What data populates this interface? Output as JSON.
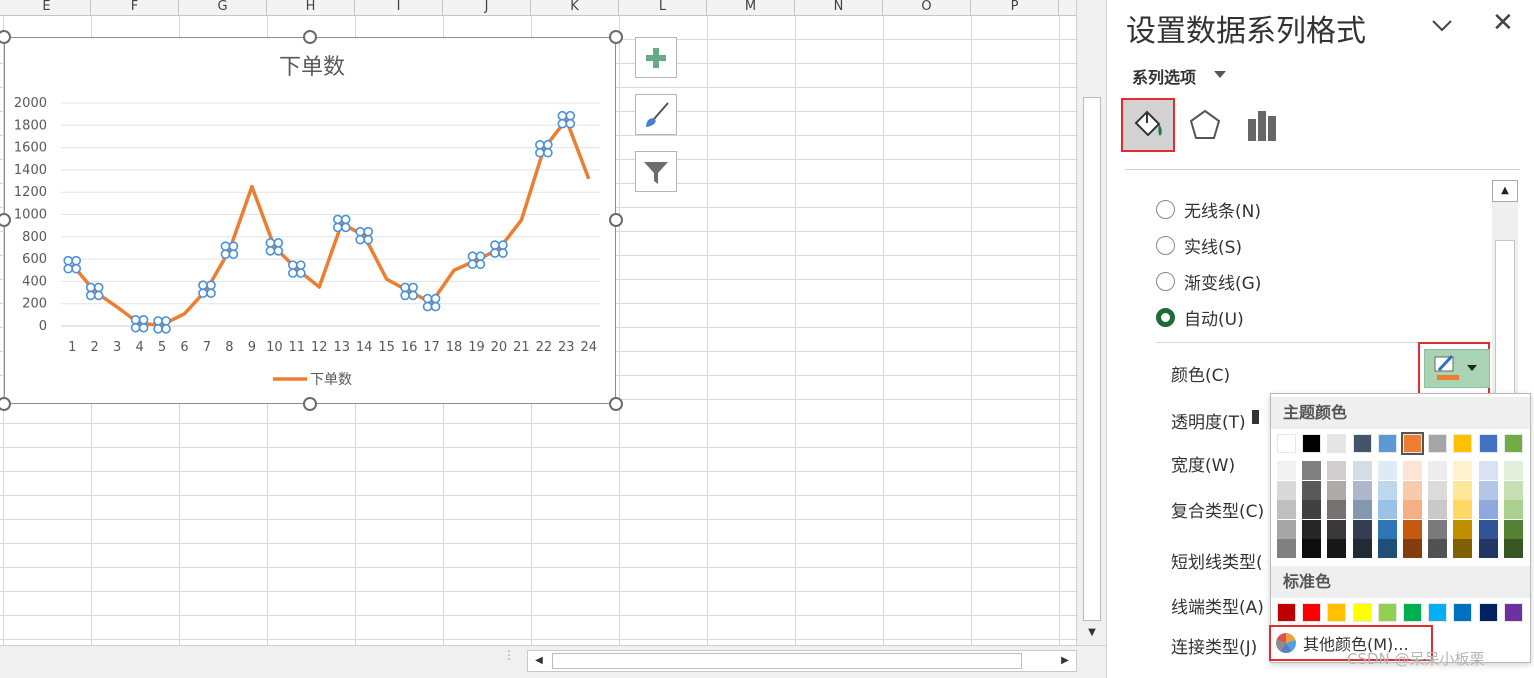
{
  "sheet": {
    "columns": [
      "E",
      "F",
      "G",
      "H",
      "I",
      "J",
      "K",
      "L",
      "M",
      "N",
      "O",
      "P"
    ]
  },
  "chart_data": {
    "type": "line",
    "title": "下单数",
    "categories": [
      "1",
      "2",
      "3",
      "4",
      "5",
      "6",
      "7",
      "8",
      "9",
      "10",
      "11",
      "12",
      "13",
      "14",
      "15",
      "16",
      "17",
      "18",
      "19",
      "20",
      "21",
      "22",
      "23",
      "24"
    ],
    "series": [
      {
        "name": "下单数",
        "color": "#ED7D31",
        "values": [
          550,
          310,
          170,
          20,
          10,
          110,
          330,
          680,
          1250,
          710,
          510,
          350,
          920,
          810,
          420,
          310,
          210,
          500,
          590,
          690,
          950,
          1590,
          1850,
          1320
        ],
        "selected_points": [
          1,
          2,
          4,
          5,
          7,
          8,
          10,
          11,
          13,
          14,
          16,
          17,
          19,
          20,
          22,
          23
        ]
      }
    ],
    "y_ticks": [
      "0",
      "200",
      "400",
      "600",
      "800",
      "1000",
      "1200",
      "1400",
      "1600",
      "1800",
      "2000"
    ],
    "ylim": [
      0,
      2000
    ],
    "grid": true,
    "legend": "bottom"
  },
  "chart_buttons": [
    {
      "name": "chart-elements-button",
      "icon": "plus-icon"
    },
    {
      "name": "chart-styles-button",
      "icon": "brush-icon"
    },
    {
      "name": "chart-filters-button",
      "icon": "filter-icon"
    }
  ],
  "pane": {
    "title": "设置数据系列格式",
    "series_options_label": "系列选项",
    "tabs": [
      {
        "name": "fill-line",
        "icon": "paint-bucket-icon",
        "active": true
      },
      {
        "name": "effects",
        "icon": "pentagon-icon",
        "active": false
      },
      {
        "name": "series-options",
        "icon": "bar-chart-icon",
        "active": false
      }
    ],
    "line_options": [
      {
        "label": "无线条(N)",
        "checked": false
      },
      {
        "label": "实线(S)",
        "checked": false
      },
      {
        "label": "渐变线(G)",
        "checked": false
      },
      {
        "label": "自动(U)",
        "checked": true
      }
    ],
    "props": {
      "color": "颜色(C)",
      "transparency": "透明度(T)",
      "width": "宽度(W)",
      "compound": "复合类型(C)",
      "dash": "短划线类型(",
      "cap": "线端类型(A)",
      "join": "连接类型(J)"
    }
  },
  "color_dropdown": {
    "theme_label": "主题颜色",
    "standard_label": "标准色",
    "more_label": "其他颜色(M)...",
    "theme_colors": [
      "#FFFFFF",
      "#000000",
      "#E7E6E6",
      "#44546A",
      "#5B9BD5",
      "#ED7D31",
      "#A5A5A5",
      "#FFC000",
      "#4472C4",
      "#70AD47"
    ],
    "theme_shades": [
      [
        "#F2F2F2",
        "#D9D9D9",
        "#BFBFBF",
        "#A6A6A6",
        "#808080"
      ],
      [
        "#808080",
        "#595959",
        "#404040",
        "#262626",
        "#0D0D0D"
      ],
      [
        "#D0CECE",
        "#AEAAAA",
        "#757171",
        "#3A3838",
        "#171717"
      ],
      [
        "#D6DCE4",
        "#ADB9CA",
        "#8497B0",
        "#333F50",
        "#222A35"
      ],
      [
        "#DDEBF7",
        "#BDD7EE",
        "#9BC2E6",
        "#2F75B5",
        "#1F4E78"
      ],
      [
        "#FCE4D6",
        "#F8CBAD",
        "#F4B084",
        "#C65911",
        "#833C0C"
      ],
      [
        "#EDEDED",
        "#DBDBDB",
        "#C9C9C9",
        "#7B7B7B",
        "#525252"
      ],
      [
        "#FFF2CC",
        "#FFE699",
        "#FFD966",
        "#BF8F00",
        "#806000"
      ],
      [
        "#D9E1F2",
        "#B4C6E7",
        "#8EA9DB",
        "#305496",
        "#203764"
      ],
      [
        "#E2EFDA",
        "#C6E0B4",
        "#A9D08E",
        "#548235",
        "#375623"
      ]
    ],
    "standard_colors": [
      "#C00000",
      "#FF0000",
      "#FFC000",
      "#FFFF00",
      "#92D050",
      "#00B050",
      "#00B0F0",
      "#0070C0",
      "#002060",
      "#7030A0"
    ]
  },
  "watermark": "CSDN @呆呆小板栗"
}
